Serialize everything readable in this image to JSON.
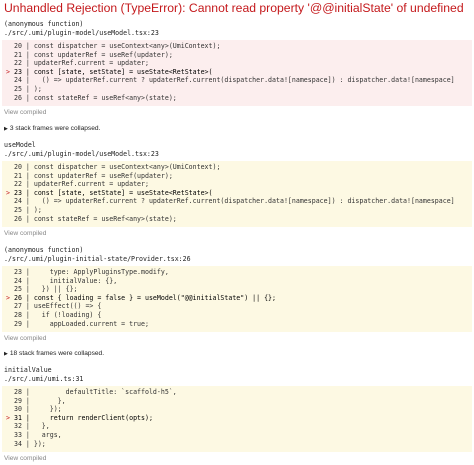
{
  "error_title": "Unhandled Rejection (TypeError): Cannot read property '@@initialState' of undefined",
  "view_compiled_label": "View compiled",
  "colors": {
    "error_red": "#c4181b",
    "error_block_bg": "#fceeee",
    "source_block_bg": "#fdf9e3",
    "link_gray": "#888888"
  },
  "icons": {
    "collapse_toggle": "triangle-right-icon"
  },
  "frames": [
    {
      "fn": "(anonymous function)",
      "path": "./src/.umi/plugin-model/useModel.tsx:23",
      "lines": [
        {
          "marker": " ",
          "num": "20",
          "code": "const dispatcher = useContext<any>(UmiContext);"
        },
        {
          "marker": " ",
          "num": "21",
          "code": "const updaterRef = useRef(updater);"
        },
        {
          "marker": " ",
          "num": "22",
          "code": "updaterRef.current = updater;"
        },
        {
          "marker": ">",
          "num": "23",
          "code": "const [state, setState] = useState<RetState>("
        },
        {
          "marker": " ",
          "num": "24",
          "code": "  () => updaterRef.current ? updaterRef.current(dispatcher.data![namespace]) : dispatcher.data![namespace]"
        },
        {
          "marker": " ",
          "num": "25",
          "code": ");"
        },
        {
          "marker": " ",
          "num": "26",
          "code": "const stateRef = useRef<any>(state);"
        }
      ]
    },
    {
      "fn": "useModel",
      "path": "./src/.umi/plugin-model/useModel.tsx:23",
      "lines": [
        {
          "marker": " ",
          "num": "20",
          "code": "const dispatcher = useContext<any>(UmiContext);"
        },
        {
          "marker": " ",
          "num": "21",
          "code": "const updaterRef = useRef(updater);"
        },
        {
          "marker": " ",
          "num": "22",
          "code": "updaterRef.current = updater;"
        },
        {
          "marker": ">",
          "num": "23",
          "code": "const [state, setState] = useState<RetState>("
        },
        {
          "marker": " ",
          "num": "24",
          "code": "  () => updaterRef.current ? updaterRef.current(dispatcher.data![namespace]) : dispatcher.data![namespace]"
        },
        {
          "marker": " ",
          "num": "25",
          "code": ");"
        },
        {
          "marker": " ",
          "num": "26",
          "code": "const stateRef = useRef<any>(state);"
        }
      ]
    },
    {
      "fn": "(anonymous function)",
      "path": "./src/.umi/plugin-initial-state/Provider.tsx:26",
      "lines": [
        {
          "marker": " ",
          "num": "23",
          "code": "    type: ApplyPluginsType.modify,"
        },
        {
          "marker": " ",
          "num": "24",
          "code": "    initialValue: {},"
        },
        {
          "marker": " ",
          "num": "25",
          "code": "  }) || {};"
        },
        {
          "marker": ">",
          "num": "26",
          "code": "const { loading = false } = useModel(\"@@initialState\") || {};"
        },
        {
          "marker": " ",
          "num": "27",
          "code": "useEffect(() => {"
        },
        {
          "marker": " ",
          "num": "28",
          "code": "  if (!loading) {"
        },
        {
          "marker": " ",
          "num": "29",
          "code": "    appLoaded.current = true;"
        }
      ]
    },
    {
      "fn": "initialValue",
      "path": "./src/.umi/umi.ts:31",
      "lines": [
        {
          "marker": " ",
          "num": "28",
          "code": "        defaultTitle: `scaffold-h5`,"
        },
        {
          "marker": " ",
          "num": "29",
          "code": "      },"
        },
        {
          "marker": " ",
          "num": "30",
          "code": "    });"
        },
        {
          "marker": ">",
          "num": "31",
          "code": "    return renderClient(opts);"
        },
        {
          "marker": " ",
          "num": "32",
          "code": "  },"
        },
        {
          "marker": " ",
          "num": "33",
          "code": "  args,"
        },
        {
          "marker": " ",
          "num": "34",
          "code": "});"
        }
      ]
    }
  ],
  "collapsed": [
    {
      "label": "3 stack frames were collapsed."
    },
    {
      "label": "18 stack frames were collapsed."
    }
  ]
}
